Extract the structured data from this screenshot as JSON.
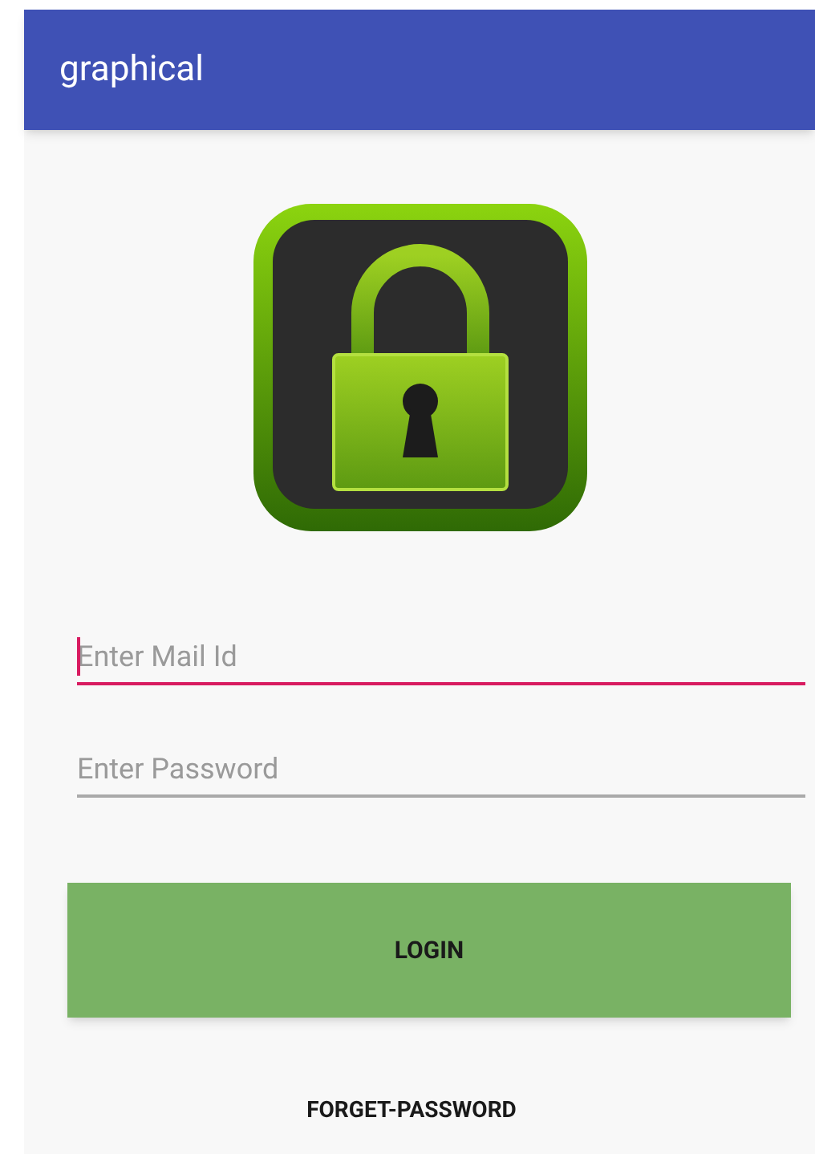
{
  "app_bar": {
    "title": "graphical"
  },
  "fields": [
    {
      "placeholder": "Enter Mail Id",
      "focused": true
    },
    {
      "placeholder": "Enter Password",
      "focused": false
    }
  ],
  "login_button": {
    "label": "LOGIN"
  },
  "forgot_link": {
    "label": "FORGET-PASSWORD"
  }
}
